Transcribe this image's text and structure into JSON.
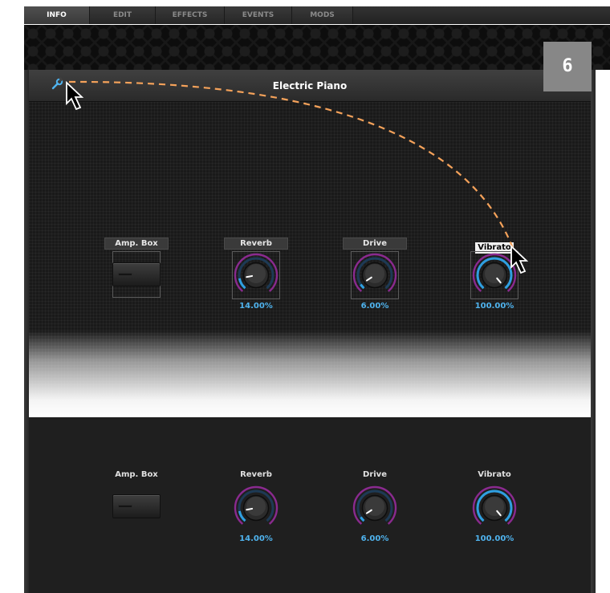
{
  "tabs": [
    {
      "label": "INFO",
      "active": true
    },
    {
      "label": "EDIT",
      "active": false
    },
    {
      "label": "EFFECTS",
      "active": false
    },
    {
      "label": "EVENTS",
      "active": false
    },
    {
      "label": "MODS",
      "active": false
    }
  ],
  "panel": {
    "title": "Electric Piano",
    "wrench_icon": "wrench-icon"
  },
  "step_badge": "6",
  "controls_top": {
    "amp_box": {
      "label": "Amp. Box"
    },
    "reverb": {
      "label": "Reverb",
      "value": "14.00%",
      "level": 0.14
    },
    "drive": {
      "label": "Drive",
      "value": "6.00%",
      "level": 0.06
    },
    "vibrato": {
      "label": "Vibrato",
      "value": "100.00%",
      "level": 1.0
    }
  },
  "controls_bottom": {
    "amp_box": {
      "label": "Amp. Box"
    },
    "reverb": {
      "label": "Reverb",
      "value": "14.00%",
      "level": 0.14
    },
    "drive": {
      "label": "Drive",
      "value": "6.00%",
      "level": 0.06
    },
    "vibrato": {
      "label": "Vibrato",
      "value": "100.00%",
      "level": 1.0
    }
  },
  "colors": {
    "value_text": "#4fb3ee",
    "ring_outer": "#8a2a8f",
    "ring_inner": "#2f9fe0",
    "arrow_dash": "#f5a25a"
  }
}
